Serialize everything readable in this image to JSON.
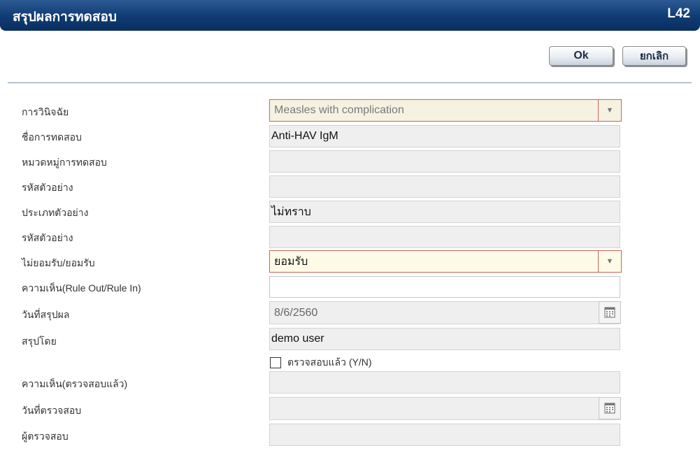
{
  "header": {
    "title": "สรุปผลการทดสอบ",
    "code": "L42"
  },
  "actions": {
    "ok_label": "Ok",
    "cancel_label": "ยกเลิก"
  },
  "form": {
    "diagnosis": {
      "label": "การวินิจฉัย",
      "value": "Measles with complication"
    },
    "test_name": {
      "label": "ชื่อการทดสอบ",
      "value": "Anti-HAV IgM"
    },
    "test_category": {
      "label": "หมวดหมู่การทดสอบ",
      "value": ""
    },
    "sample_code_1": {
      "label": "รหัสตัวอย่าง",
      "value": ""
    },
    "sample_type": {
      "label": "ประเภทตัวอย่าง",
      "value": "ไม่ทราบ"
    },
    "sample_code_2": {
      "label": "รหัสตัวอย่าง",
      "value": ""
    },
    "accept_reject": {
      "label": "ไม่ยอมรับ/ยอมรับ",
      "value": "ยอมรับ"
    },
    "opinion_rule": {
      "label": "ความเห็น(Rule Out/Rule In)",
      "value": ""
    },
    "summary_date": {
      "label": "วันที่สรุปผล",
      "value": "8/6/2560"
    },
    "summary_by": {
      "label": "สรุปโดย",
      "value": "demo user"
    },
    "verified": {
      "label": "ตรวจสอบแล้ว (Y/N)",
      "checked": false
    },
    "verify_opinion": {
      "label": "ความเห็น(ตรวจสอบแล้ว)",
      "value": ""
    },
    "verify_date": {
      "label": "วันที่ตรวจสอบ",
      "value": ""
    },
    "verifier": {
      "label": "ผู้ตรวจสอบ",
      "value": ""
    }
  },
  "icons": {
    "dropdown": "chevron-down-icon",
    "calendar": "calendar-icon"
  },
  "colors": {
    "title_bar": "#0f3b73",
    "select_border": "#c9655b"
  }
}
